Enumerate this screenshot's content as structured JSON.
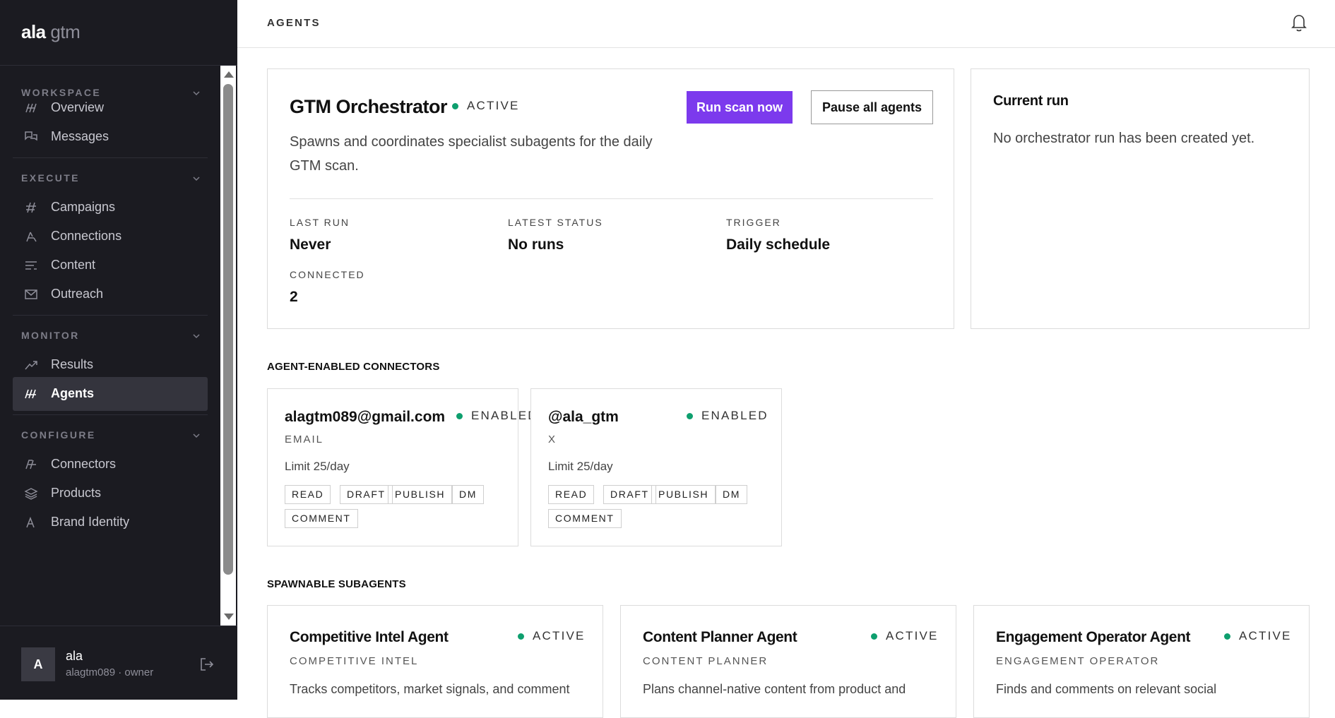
{
  "brand": {
    "part1": "ala",
    "part2": "gtm"
  },
  "sidebar": {
    "sections": [
      {
        "title": "WORKSPACE",
        "items": [
          {
            "label": "Overview",
            "icon": "overview-icon"
          },
          {
            "label": "Messages",
            "icon": "messages-icon"
          }
        ]
      },
      {
        "title": "EXECUTE",
        "items": [
          {
            "label": "Campaigns",
            "icon": "campaigns-icon"
          },
          {
            "label": "Connections",
            "icon": "connections-icon"
          },
          {
            "label": "Content",
            "icon": "content-icon"
          },
          {
            "label": "Outreach",
            "icon": "outreach-icon"
          }
        ]
      },
      {
        "title": "MONITOR",
        "items": [
          {
            "label": "Results",
            "icon": "trend-up-icon"
          },
          {
            "label": "Agents",
            "icon": "agents-icon",
            "active": true
          }
        ]
      },
      {
        "title": "CONFIGURE",
        "items": [
          {
            "label": "Connectors",
            "icon": "connectors-icon"
          },
          {
            "label": "Products",
            "icon": "layers-icon"
          },
          {
            "label": "Brand Identity",
            "icon": "brand-icon"
          }
        ]
      }
    ]
  },
  "user": {
    "initial": "A",
    "name": "ala",
    "meta": "alagtm089 · owner"
  },
  "header": {
    "title": "AGENTS"
  },
  "orchestrator": {
    "title": "GTM Orchestrator",
    "status": "ACTIVE",
    "description": "Spawns and coordinates specialist subagents for the daily GTM scan.",
    "run_button": "Run scan now",
    "pause_button": "Pause all agents",
    "stats": [
      {
        "label": "LAST RUN",
        "value": "Never"
      },
      {
        "label": "LATEST STATUS",
        "value": "No runs"
      },
      {
        "label": "TRIGGER",
        "value": "Daily schedule"
      },
      {
        "label": "CONNECTED",
        "value": "2"
      }
    ]
  },
  "current_run": {
    "title": "Current run",
    "text": "No orchestrator run has been created yet."
  },
  "connectors_section": {
    "title": "AGENT-ENABLED CONNECTORS"
  },
  "connectors": [
    {
      "name": "alagtm089@gmail.com",
      "status": "ENABLED",
      "type": "EMAIL",
      "limit": "Limit 25/day",
      "tags": [
        "READ",
        "DRAFT",
        "PUBLISH",
        "DM",
        "COMMENT"
      ]
    },
    {
      "name": "@ala_gtm",
      "status": "ENABLED",
      "type": "X",
      "limit": "Limit 25/day",
      "tags": [
        "READ",
        "DRAFT",
        "PUBLISH",
        "DM",
        "COMMENT"
      ]
    }
  ],
  "subagents_section": {
    "title": "SPAWNABLE SUBAGENTS"
  },
  "subagents": [
    {
      "title": "Competitive Intel Agent",
      "status": "ACTIVE",
      "type": "COMPETITIVE INTEL",
      "description": "Tracks competitors, market signals, and comment"
    },
    {
      "title": "Content Planner Agent",
      "status": "ACTIVE",
      "type": "CONTENT PLANNER",
      "description": "Plans channel-native content from product and"
    },
    {
      "title": "Engagement Operator Agent",
      "status": "ACTIVE",
      "type": "ENGAGEMENT OPERATOR",
      "description": "Finds and comments on relevant social"
    }
  ],
  "colors": {
    "accent": "#7c3aed",
    "status_green": "#0e9f6e",
    "sidebar_bg": "#1b1b21"
  }
}
